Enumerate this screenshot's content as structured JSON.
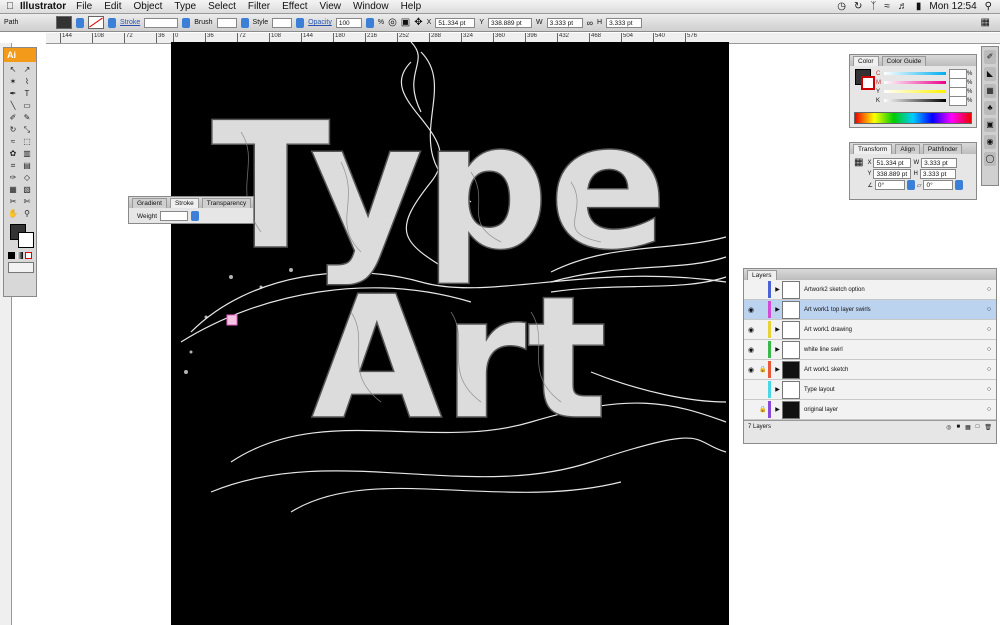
{
  "menubar": {
    "app": "Illustrator",
    "items": [
      "File",
      "Edit",
      "Object",
      "Type",
      "Select",
      "Filter",
      "Effect",
      "View",
      "Window",
      "Help"
    ],
    "clock": "Mon 12:54"
  },
  "control": {
    "selection": "Path",
    "stroke_label": "Stroke",
    "brush_label": "Brush",
    "style_label": "Style",
    "opacity_label": "Opacity",
    "opacity_value": "100",
    "opacity_unit": "%",
    "x_label": "X",
    "x_value": "51.334 pt",
    "y_label": "Y",
    "y_value": "338.889 pt",
    "w_label": "W",
    "w_value": "3.333 pt",
    "h_label": "H",
    "h_value": "3.333 pt"
  },
  "ruler": {
    "marks": [
      "144",
      "108",
      "72",
      "36",
      "0",
      "36",
      "72",
      "108",
      "144",
      "180",
      "216",
      "252",
      "288",
      "324",
      "360",
      "396",
      "432",
      "468",
      "504",
      "540",
      "576"
    ]
  },
  "artwork": {
    "line1": "Type",
    "line2": "Art"
  },
  "tools": {
    "logo": "Ai",
    "icons": [
      "selection-icon",
      "direct-selection-icon",
      "magic-wand-icon",
      "lasso-icon",
      "pen-icon",
      "type-icon",
      "line-icon",
      "rectangle-icon",
      "paintbrush-icon",
      "pencil-icon",
      "rotate-icon",
      "scale-icon",
      "warp-icon",
      "free-transform-icon",
      "symbol-sprayer-icon",
      "column-graph-icon",
      "mesh-icon",
      "gradient-icon",
      "eyedropper-icon",
      "blend-icon",
      "live-paint-icon",
      "live-paint-selection-icon",
      "slice-icon",
      "scissors-icon",
      "hand-icon",
      "zoom-icon"
    ],
    "glyphs": [
      "↖",
      "↗",
      "✶",
      "⌇",
      "✒",
      "T",
      "╲",
      "▭",
      "✐",
      "✎",
      "↻",
      "⤡",
      "≈",
      "⬚",
      "✿",
      "▥",
      "⌗",
      "▤",
      "✑",
      "◇",
      "▦",
      "▧",
      "✂",
      "✄",
      "✋",
      "⚲"
    ]
  },
  "stroke_panel": {
    "tabs": [
      "Gradient",
      "Stroke",
      "Transparency"
    ],
    "weight_label": "Weight"
  },
  "color_panel": {
    "tabs": [
      "Color",
      "Color Guide"
    ],
    "channels": [
      "C",
      "M",
      "Y",
      "K"
    ],
    "unit": "%"
  },
  "transform_panel": {
    "tabs": [
      "Transform",
      "Align",
      "Pathfinder"
    ],
    "x_label": "X",
    "x_value": "51.334 pt",
    "y_label": "Y",
    "y_value": "338.889 pt",
    "w_label": "W",
    "w_value": "3.333 pt",
    "h_label": "H",
    "h_value": "3.333 pt",
    "angle1": "0°",
    "angle2": "0°"
  },
  "layers_panel": {
    "tab": "Layers",
    "rows": [
      {
        "name": "Artwork2 sketch option",
        "visible": false,
        "locked": false,
        "color": "#4a64d8"
      },
      {
        "name": "Art work1 top layer swirls",
        "visible": true,
        "locked": false,
        "color": "#d24ad8"
      },
      {
        "name": "Art work1 drawing",
        "visible": true,
        "locked": false,
        "color": "#e8d23a"
      },
      {
        "name": "white line swirl",
        "visible": true,
        "locked": false,
        "color": "#3ab84a"
      },
      {
        "name": "Art work1 sketch",
        "visible": true,
        "locked": true,
        "color": "#e85a3a"
      },
      {
        "name": "Type layout",
        "visible": false,
        "locked": false,
        "color": "#4ad8e8"
      },
      {
        "name": "original layer",
        "visible": false,
        "locked": true,
        "color": "#8a4ad8"
      }
    ],
    "count": "7 Layers"
  }
}
